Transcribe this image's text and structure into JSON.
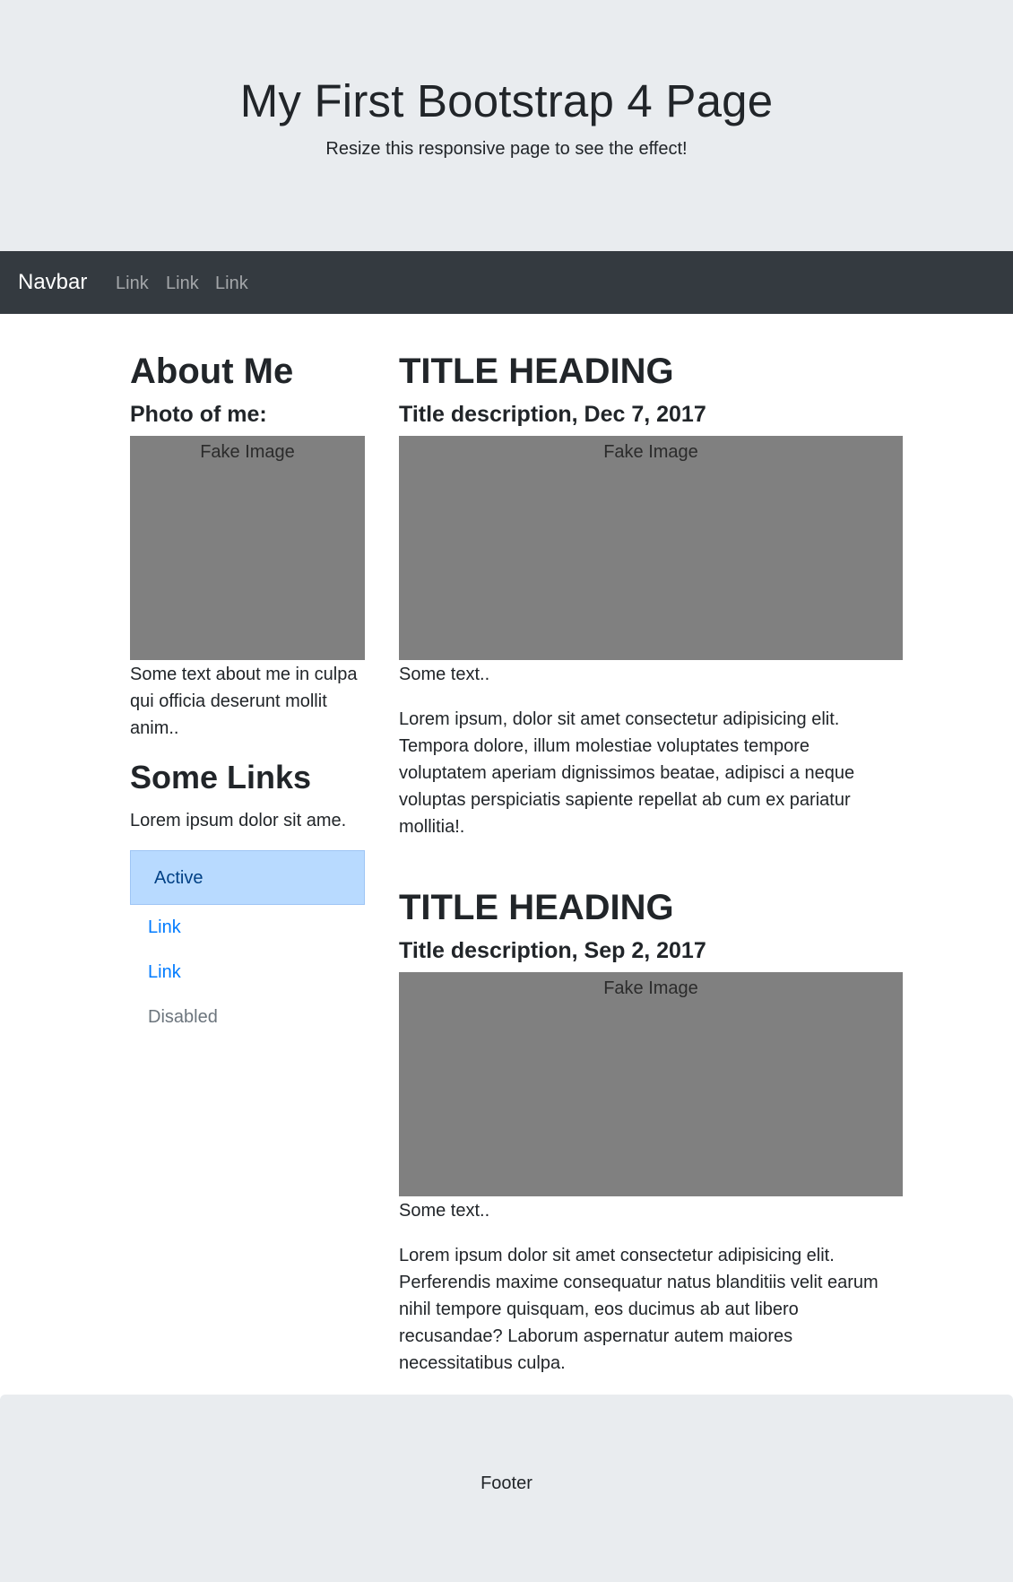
{
  "jumbotron": {
    "title": "My First Bootstrap 4 Page",
    "subtitle": "Resize this responsive page to see the effect!"
  },
  "navbar": {
    "brand": "Navbar",
    "links": [
      "Link",
      "Link",
      "Link"
    ]
  },
  "sidebar": {
    "about_heading": "About Me",
    "photo_label": "Photo of me:",
    "image_text": "Fake Image",
    "about_text": "Some text about me in culpa qui officia deserunt mollit anim..",
    "links_heading": "Some Links",
    "links_text": "Lorem ipsum dolor sit ame.",
    "nav_items": [
      {
        "label": "Active",
        "state": "active"
      },
      {
        "label": "Link",
        "state": "link"
      },
      {
        "label": "Link",
        "state": "link"
      },
      {
        "label": "Disabled",
        "state": "disabled"
      }
    ]
  },
  "posts": [
    {
      "heading": "TITLE HEADING",
      "description": "Title description, Dec 7, 2017",
      "image_text": "Fake Image",
      "short_text": "Some text..",
      "body": "Lorem ipsum, dolor sit amet consectetur adipisicing elit. Tempora dolore, illum molestiae voluptates tempore voluptatem aperiam dignissimos beatae, adipisci a neque voluptas perspiciatis sapiente repellat ab cum ex pariatur mollitia!."
    },
    {
      "heading": "TITLE HEADING",
      "description": "Title description, Sep 2, 2017",
      "image_text": "Fake Image",
      "short_text": "Some text..",
      "body": "Lorem ipsum dolor sit amet consectetur adipisicing elit. Perferendis maxime consequatur natus blanditiis velit earum nihil tempore quisquam, eos ducimus ab aut libero recusandae? Laborum aspernatur autem maiores necessitatibus culpa."
    }
  ],
  "footer": {
    "text": "Footer"
  },
  "colors": {
    "jumbotron_bg": "#e9ecef",
    "navbar_bg": "#343a40",
    "link": "#007bff",
    "disabled": "#6c757d",
    "active_bg": "#b8daff",
    "image_bg": "#808080"
  }
}
